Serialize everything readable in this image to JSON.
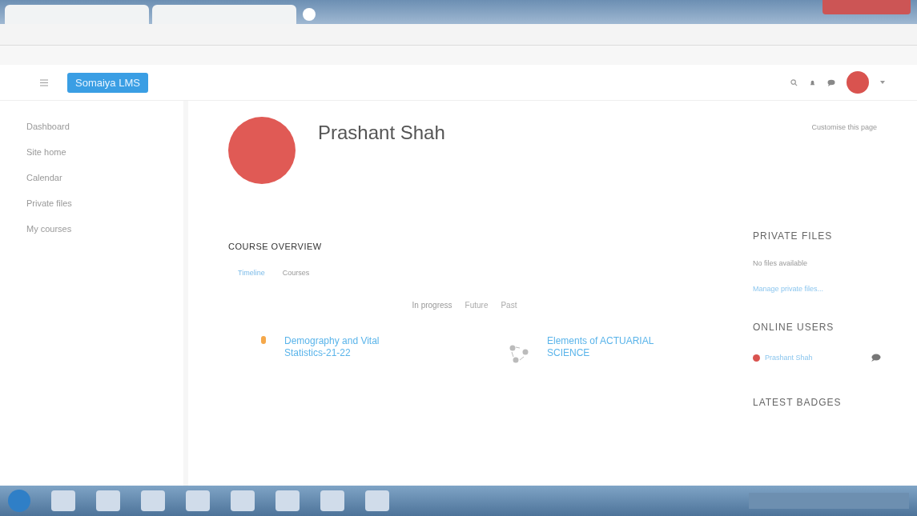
{
  "navbar": {
    "brand": "Somaiya LMS"
  },
  "sidebar": {
    "items": [
      {
        "label": "Dashboard",
        "selected": false
      },
      {
        "label": "Site home",
        "selected": false
      },
      {
        "label": "Calendar",
        "selected": false
      },
      {
        "label": "Private files",
        "selected": false
      },
      {
        "label": "My courses",
        "selected": false
      }
    ]
  },
  "profile": {
    "name": "Prashant Shah",
    "customise": "Customise this page"
  },
  "course_overview": {
    "title": "COURSE OVERVIEW",
    "tabs": [
      {
        "label": "Timeline",
        "selected": true
      },
      {
        "label": "Courses",
        "selected": false
      }
    ],
    "filters": [
      {
        "label": "In progress",
        "selected": true
      },
      {
        "label": "Future",
        "selected": false
      },
      {
        "label": "Past",
        "selected": false
      }
    ],
    "courses": [
      {
        "name": "Demography and Vital Statistics-21-22",
        "kind": "dot"
      },
      {
        "name": "Elements of ACTUARIAL SCIENCE",
        "kind": "molecule"
      }
    ]
  },
  "private_files": {
    "title": "PRIVATE FILES",
    "empty": "No files available",
    "link": "Manage private files..."
  },
  "online_users": {
    "title": "ONLINE USERS",
    "users": [
      {
        "name": "Prashant Shah"
      }
    ]
  },
  "latest_badges": {
    "title": "LATEST BADGES"
  }
}
